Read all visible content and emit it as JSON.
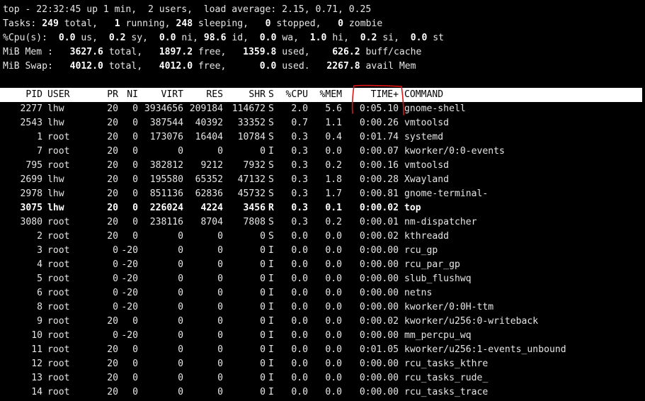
{
  "summary": {
    "uptime_line": "top - 22:32:45 up 1 min,  2 users,  load average: 2.15, 0.71, 0.25",
    "tasks": {
      "label": "Tasks:",
      "total": "249",
      "total_lbl": "total,",
      "running": "1",
      "running_lbl": "running,",
      "sleeping": "248",
      "sleeping_lbl": "sleeping,",
      "stopped": "0",
      "stopped_lbl": "stopped,",
      "zombie": "0",
      "zombie_lbl": "zombie"
    },
    "cpu": {
      "label": "%Cpu(s):",
      "us": "0.0",
      "us_lbl": "us,",
      "sy": "0.2",
      "sy_lbl": "sy,",
      "ni": "0.0",
      "ni_lbl": "ni,",
      "id": "98.6",
      "id_lbl": "id,",
      "wa": "0.0",
      "wa_lbl": "wa,",
      "hi": "1.0",
      "hi_lbl": "hi,",
      "si": "0.2",
      "si_lbl": "si,",
      "st": "0.0",
      "st_lbl": "st"
    },
    "mem": {
      "label": "MiB Mem :",
      "total": "3627.6",
      "total_lbl": "total,",
      "free": "1897.2",
      "free_lbl": "free,",
      "used": "1359.8",
      "used_lbl": "used,",
      "buff": "626.2",
      "buff_lbl": "buff/cache"
    },
    "swap": {
      "label": "MiB Swap:",
      "total": "4012.0",
      "total_lbl": "total,",
      "free": "4012.0",
      "free_lbl": "free,",
      "used": "0.0",
      "used_lbl": "used.",
      "avail": "2267.8",
      "avail_lbl": "avail Mem"
    }
  },
  "columns": [
    "PID",
    "USER",
    "PR",
    "NI",
    "VIRT",
    "RES",
    "SHR",
    "S",
    "%CPU",
    "%MEM",
    "TIME+",
    "COMMAND"
  ],
  "processes": [
    {
      "pid": "2277",
      "user": "lhw",
      "pr": "20",
      "ni": "0",
      "virt": "3934656",
      "res": "209184",
      "shr": "114672",
      "s": "S",
      "cpu": "2.0",
      "mem": "5.6",
      "time": "0:05.10",
      "cmd": "gnome-shell"
    },
    {
      "pid": "2543",
      "user": "lhw",
      "pr": "20",
      "ni": "0",
      "virt": "387544",
      "res": "40392",
      "shr": "33352",
      "s": "S",
      "cpu": "0.7",
      "mem": "1.1",
      "time": "0:00.26",
      "cmd": "vmtoolsd"
    },
    {
      "pid": "1",
      "user": "root",
      "pr": "20",
      "ni": "0",
      "virt": "173076",
      "res": "16404",
      "shr": "10784",
      "s": "S",
      "cpu": "0.3",
      "mem": "0.4",
      "time": "0:01.74",
      "cmd": "systemd"
    },
    {
      "pid": "7",
      "user": "root",
      "pr": "20",
      "ni": "0",
      "virt": "0",
      "res": "0",
      "shr": "0",
      "s": "I",
      "cpu": "0.3",
      "mem": "0.0",
      "time": "0:00.07",
      "cmd": "kworker/0:0-events"
    },
    {
      "pid": "795",
      "user": "root",
      "pr": "20",
      "ni": "0",
      "virt": "382812",
      "res": "9212",
      "shr": "7932",
      "s": "S",
      "cpu": "0.3",
      "mem": "0.2",
      "time": "0:00.16",
      "cmd": "vmtoolsd"
    },
    {
      "pid": "2699",
      "user": "lhw",
      "pr": "20",
      "ni": "0",
      "virt": "195580",
      "res": "65352",
      "shr": "47132",
      "s": "S",
      "cpu": "0.3",
      "mem": "1.8",
      "time": "0:00.28",
      "cmd": "Xwayland"
    },
    {
      "pid": "2978",
      "user": "lhw",
      "pr": "20",
      "ni": "0",
      "virt": "851136",
      "res": "62836",
      "shr": "45732",
      "s": "S",
      "cpu": "0.3",
      "mem": "1.7",
      "time": "0:00.81",
      "cmd": "gnome-terminal-"
    },
    {
      "pid": "3075",
      "user": "lhw",
      "pr": "20",
      "ni": "0",
      "virt": "226024",
      "res": "4224",
      "shr": "3456",
      "s": "R",
      "cpu": "0.3",
      "mem": "0.1",
      "time": "0:00.02",
      "cmd": "top",
      "bold": true
    },
    {
      "pid": "3080",
      "user": "root",
      "pr": "20",
      "ni": "0",
      "virt": "238116",
      "res": "8704",
      "shr": "7808",
      "s": "S",
      "cpu": "0.3",
      "mem": "0.2",
      "time": "0:00.01",
      "cmd": "nm-dispatcher"
    },
    {
      "pid": "2",
      "user": "root",
      "pr": "20",
      "ni": "0",
      "virt": "0",
      "res": "0",
      "shr": "0",
      "s": "S",
      "cpu": "0.0",
      "mem": "0.0",
      "time": "0:00.02",
      "cmd": "kthreadd"
    },
    {
      "pid": "3",
      "user": "root",
      "pr": "0",
      "ni": "-20",
      "virt": "0",
      "res": "0",
      "shr": "0",
      "s": "I",
      "cpu": "0.0",
      "mem": "0.0",
      "time": "0:00.00",
      "cmd": "rcu_gp"
    },
    {
      "pid": "4",
      "user": "root",
      "pr": "0",
      "ni": "-20",
      "virt": "0",
      "res": "0",
      "shr": "0",
      "s": "I",
      "cpu": "0.0",
      "mem": "0.0",
      "time": "0:00.00",
      "cmd": "rcu_par_gp"
    },
    {
      "pid": "5",
      "user": "root",
      "pr": "0",
      "ni": "-20",
      "virt": "0",
      "res": "0",
      "shr": "0",
      "s": "I",
      "cpu": "0.0",
      "mem": "0.0",
      "time": "0:00.00",
      "cmd": "slub_flushwq"
    },
    {
      "pid": "6",
      "user": "root",
      "pr": "0",
      "ni": "-20",
      "virt": "0",
      "res": "0",
      "shr": "0",
      "s": "I",
      "cpu": "0.0",
      "mem": "0.0",
      "time": "0:00.00",
      "cmd": "netns"
    },
    {
      "pid": "8",
      "user": "root",
      "pr": "0",
      "ni": "-20",
      "virt": "0",
      "res": "0",
      "shr": "0",
      "s": "I",
      "cpu": "0.0",
      "mem": "0.0",
      "time": "0:00.00",
      "cmd": "kworker/0:0H-ttm"
    },
    {
      "pid": "9",
      "user": "root",
      "pr": "20",
      "ni": "0",
      "virt": "0",
      "res": "0",
      "shr": "0",
      "s": "I",
      "cpu": "0.0",
      "mem": "0.0",
      "time": "0:00.02",
      "cmd": "kworker/u256:0-writeback"
    },
    {
      "pid": "10",
      "user": "root",
      "pr": "0",
      "ni": "-20",
      "virt": "0",
      "res": "0",
      "shr": "0",
      "s": "I",
      "cpu": "0.0",
      "mem": "0.0",
      "time": "0:00.00",
      "cmd": "mm_percpu_wq"
    },
    {
      "pid": "11",
      "user": "root",
      "pr": "20",
      "ni": "0",
      "virt": "0",
      "res": "0",
      "shr": "0",
      "s": "I",
      "cpu": "0.0",
      "mem": "0.0",
      "time": "0:01.05",
      "cmd": "kworker/u256:1-events_unbound"
    },
    {
      "pid": "12",
      "user": "root",
      "pr": "20",
      "ni": "0",
      "virt": "0",
      "res": "0",
      "shr": "0",
      "s": "I",
      "cpu": "0.0",
      "mem": "0.0",
      "time": "0:00.00",
      "cmd": "rcu_tasks_kthre"
    },
    {
      "pid": "13",
      "user": "root",
      "pr": "20",
      "ni": "0",
      "virt": "0",
      "res": "0",
      "shr": "0",
      "s": "I",
      "cpu": "0.0",
      "mem": "0.0",
      "time": "0:00.00",
      "cmd": "rcu_tasks_rude_"
    },
    {
      "pid": "14",
      "user": "root",
      "pr": "20",
      "ni": "0",
      "virt": "0",
      "res": "0",
      "shr": "0",
      "s": "I",
      "cpu": "0.0",
      "mem": "0.0",
      "time": "0:00.00",
      "cmd": "rcu_tasks_trace"
    }
  ],
  "colors": {
    "background": "#000000",
    "text": "#e6e6e6",
    "header_bg": "#ffffff",
    "header_text": "#000000",
    "annotation": "#e01515"
  }
}
